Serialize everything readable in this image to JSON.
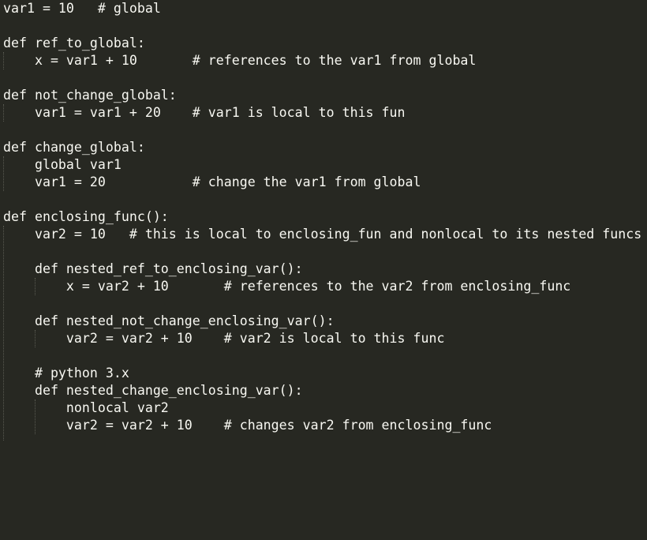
{
  "editor": {
    "background": "#272822",
    "text_color": "#f8f8f2",
    "guide_color": "#5a5b52",
    "lines": [
      "var1 = 10   # global",
      "",
      "def ref_to_global:",
      "    x = var1 + 10       # references to the var1 from global",
      "",
      "def not_change_global:",
      "    var1 = var1 + 20    # var1 is local to this fun",
      "",
      "def change_global:",
      "    global var1",
      "    var1 = 20           # change the var1 from global",
      "",
      "def enclosing_func():",
      "    var2 = 10   # this is local to enclosing_fun and nonlocal to its nested funcs",
      "",
      "    def nested_ref_to_enclosing_var():",
      "        x = var2 + 10       # references to the var2 from enclosing_func",
      "",
      "    def nested_not_change_enclosing_var():",
      "        var2 = var2 + 10    # var2 is local to this func",
      "",
      "    # python 3.x",
      "    def nested_change_enclosing_var():",
      "        nonlocal var2",
      "        var2 = var2 + 10    # changes var2 from enclosing_func"
    ]
  }
}
